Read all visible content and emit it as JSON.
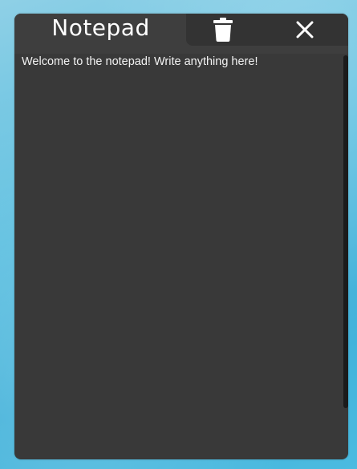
{
  "window": {
    "title": "Notepad"
  },
  "toolbar": {
    "delete_icon": "trash-icon",
    "close_icon": "close-icon"
  },
  "editor": {
    "text": "Welcome to the notepad! Write anything here!"
  },
  "colors": {
    "window_bg": "#393939",
    "titlebar_bg": "#3e3e3e",
    "actions_bg": "#333333",
    "text": "#f2f2f2",
    "desktop_blue": "#4bbbe0"
  }
}
